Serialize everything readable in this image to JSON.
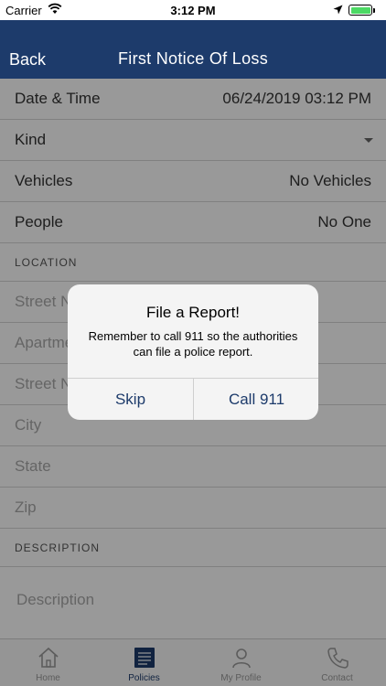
{
  "status_bar": {
    "carrier": "Carrier",
    "time": "3:12 PM",
    "battery_color": "#4cd964"
  },
  "nav": {
    "back_label": "Back",
    "title": "First Notice Of Loss",
    "background": "#1d3b6b"
  },
  "form": {
    "rows": [
      {
        "label": "Date & Time",
        "value": "06/24/2019 03:12 PM"
      },
      {
        "label": "Kind",
        "value": ""
      },
      {
        "label": "Vehicles",
        "value": "No Vehicles"
      },
      {
        "label": "People",
        "value": "No One"
      }
    ],
    "location_header": "LOCATION",
    "location_fields": [
      {
        "placeholder": "Street N"
      },
      {
        "placeholder": "Apartme"
      },
      {
        "placeholder": "Street N"
      },
      {
        "placeholder": "City"
      },
      {
        "placeholder": "State"
      },
      {
        "placeholder": "Zip"
      }
    ],
    "description_header": "DESCRIPTION",
    "description_placeholder": "Description"
  },
  "tabs": [
    {
      "label": "Home",
      "icon": "home-icon"
    },
    {
      "label": "Policies",
      "icon": "policies-icon"
    },
    {
      "label": "My Profile",
      "icon": "profile-icon"
    },
    {
      "label": "Contact",
      "icon": "phone-icon"
    }
  ],
  "alert": {
    "title": "File a Report!",
    "message": "Remember to call 911 so the authorities can file a police report.",
    "skip_label": "Skip",
    "call_label": "Call 911"
  }
}
